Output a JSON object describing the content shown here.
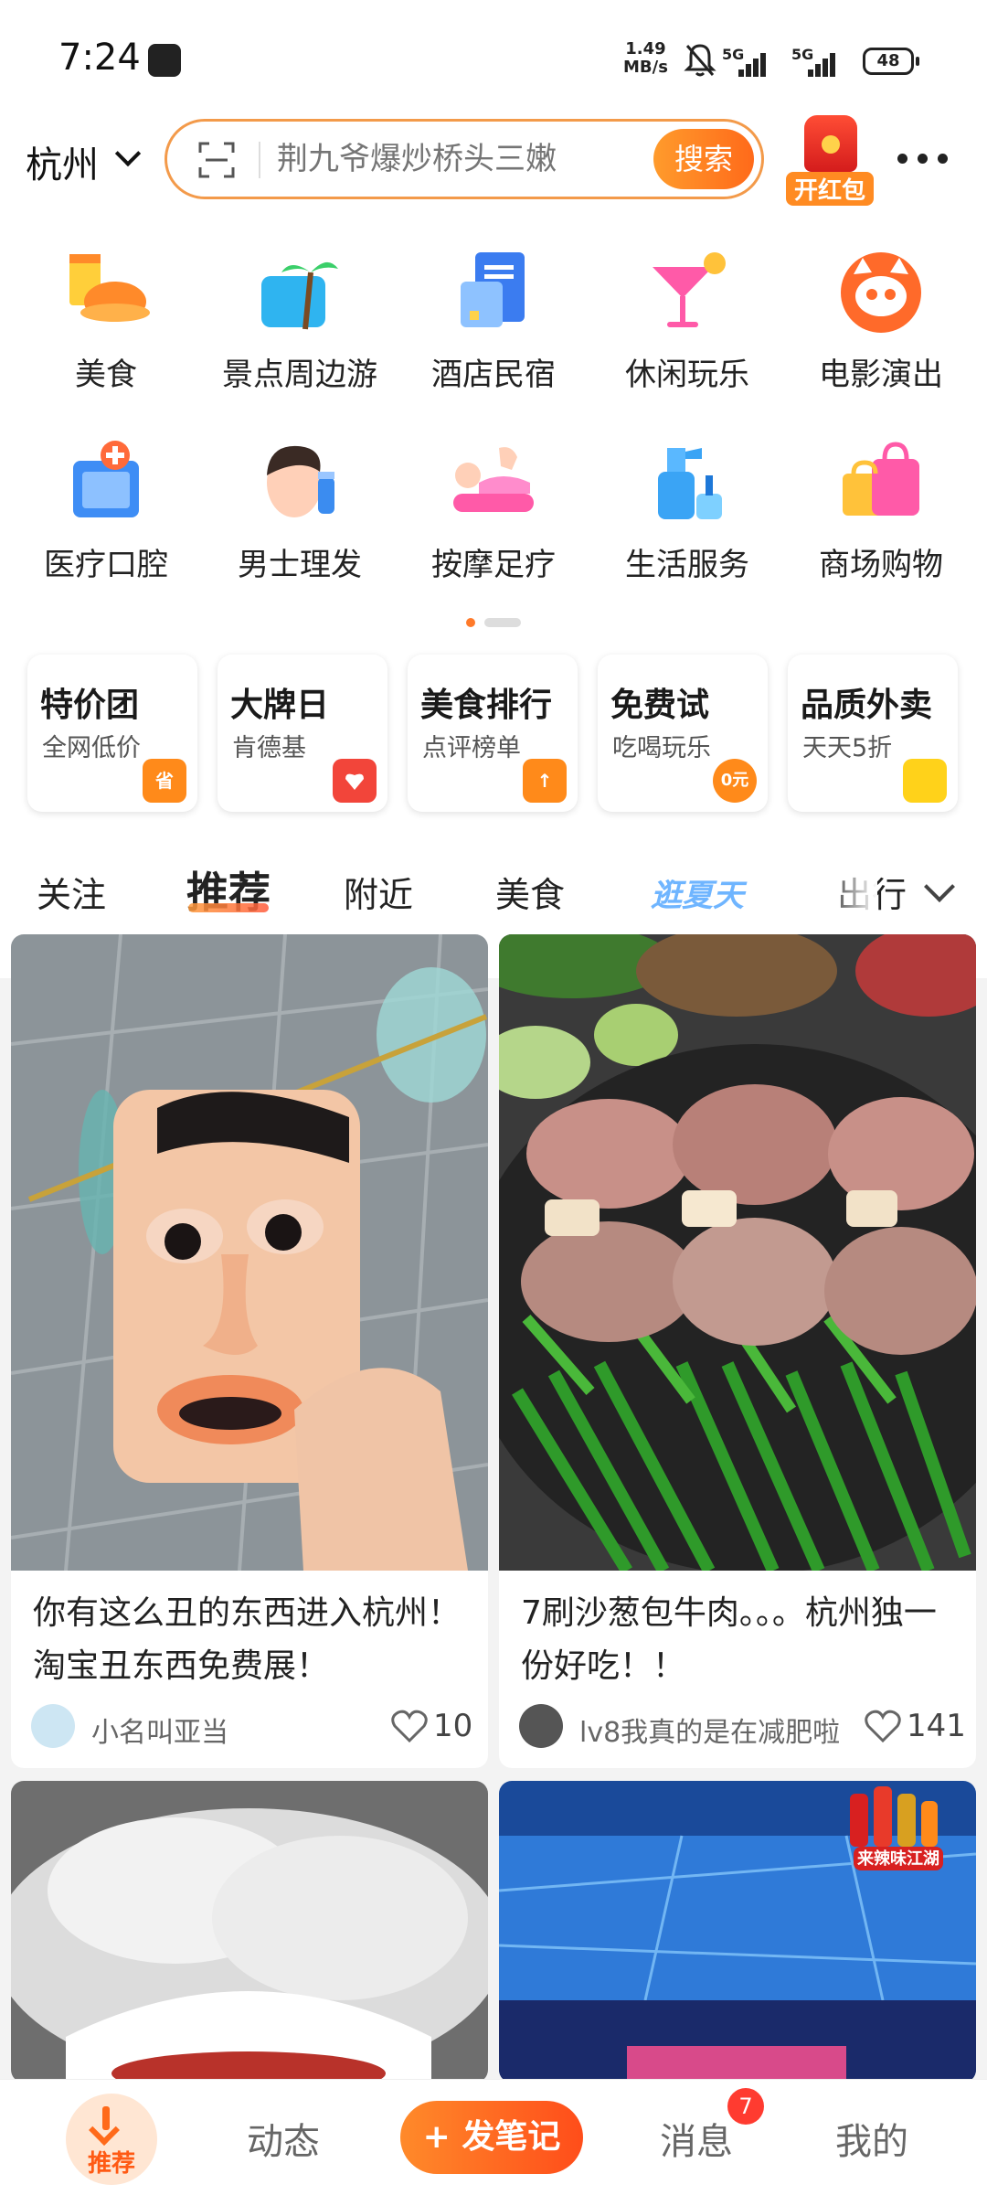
{
  "status": {
    "time": "7:24",
    "net_speed_value": "1.49",
    "net_speed_unit": "MB/s",
    "signal1": "5G",
    "signal2": "5G",
    "battery": "48"
  },
  "header": {
    "city": "杭州",
    "search_placeholder": "荆九爷爆炒桥头三嫩",
    "search_button": "搜索",
    "redpacket_label": "开红包"
  },
  "categories": [
    {
      "label": "美食",
      "icon": "food-icon"
    },
    {
      "label": "景点周边游",
      "icon": "palm-tree-icon"
    },
    {
      "label": "酒店民宿",
      "icon": "hotel-icon"
    },
    {
      "label": "休闲玩乐",
      "icon": "cocktail-icon"
    },
    {
      "label": "电影演出",
      "icon": "cat-movie-icon"
    },
    {
      "label": "医疗口腔",
      "icon": "medical-icon"
    },
    {
      "label": "男士理发",
      "icon": "barber-icon"
    },
    {
      "label": "按摩足疗",
      "icon": "massage-icon"
    },
    {
      "label": "生活服务",
      "icon": "spray-bottle-icon"
    },
    {
      "label": "商场购物",
      "icon": "shopping-bag-icon"
    }
  ],
  "promos": [
    {
      "title": "特价团",
      "subtitle": "全网低价",
      "badge": "省",
      "badge_color": "#ff8a1a"
    },
    {
      "title": "大牌日",
      "subtitle": "肯德基",
      "badge": "",
      "badge_color": "#f2453a"
    },
    {
      "title": "美食排行",
      "subtitle": "点评榜单",
      "badge": "↑",
      "badge_color": "#ff8a1a"
    },
    {
      "title": "免费试",
      "subtitle": "吃喝玩乐",
      "badge": "0元",
      "badge_color": "#ff8a1a"
    },
    {
      "title": "品质外卖",
      "subtitle": "天天5折",
      "badge": "",
      "badge_color": "#ffd21a"
    }
  ],
  "tabs": [
    "关注",
    "推荐",
    "附近",
    "美食",
    "逛夏天",
    "出行"
  ],
  "feed": [
    {
      "title": "你有这么丑的东西进入杭州！淘宝丑东西免费展！",
      "user": "小名叫亚当",
      "likes": "10"
    },
    {
      "title": "7刷沙葱包牛肉。。。杭州独一份好吃！！",
      "user": "lv8我真的是在减肥啦",
      "likes": "141"
    },
    {
      "title": "",
      "user": "",
      "likes": ""
    },
    {
      "title": "",
      "user": "",
      "likes": "",
      "banner": "来辣味江湖"
    }
  ],
  "bottom_nav": {
    "home": "推荐",
    "feed": "动态",
    "post": "+ 发笔记",
    "messages": "消息",
    "messages_badge": "7",
    "me": "我的"
  },
  "colors": {
    "accent": "#ff6a1a",
    "search_border": "#f39a4a"
  }
}
